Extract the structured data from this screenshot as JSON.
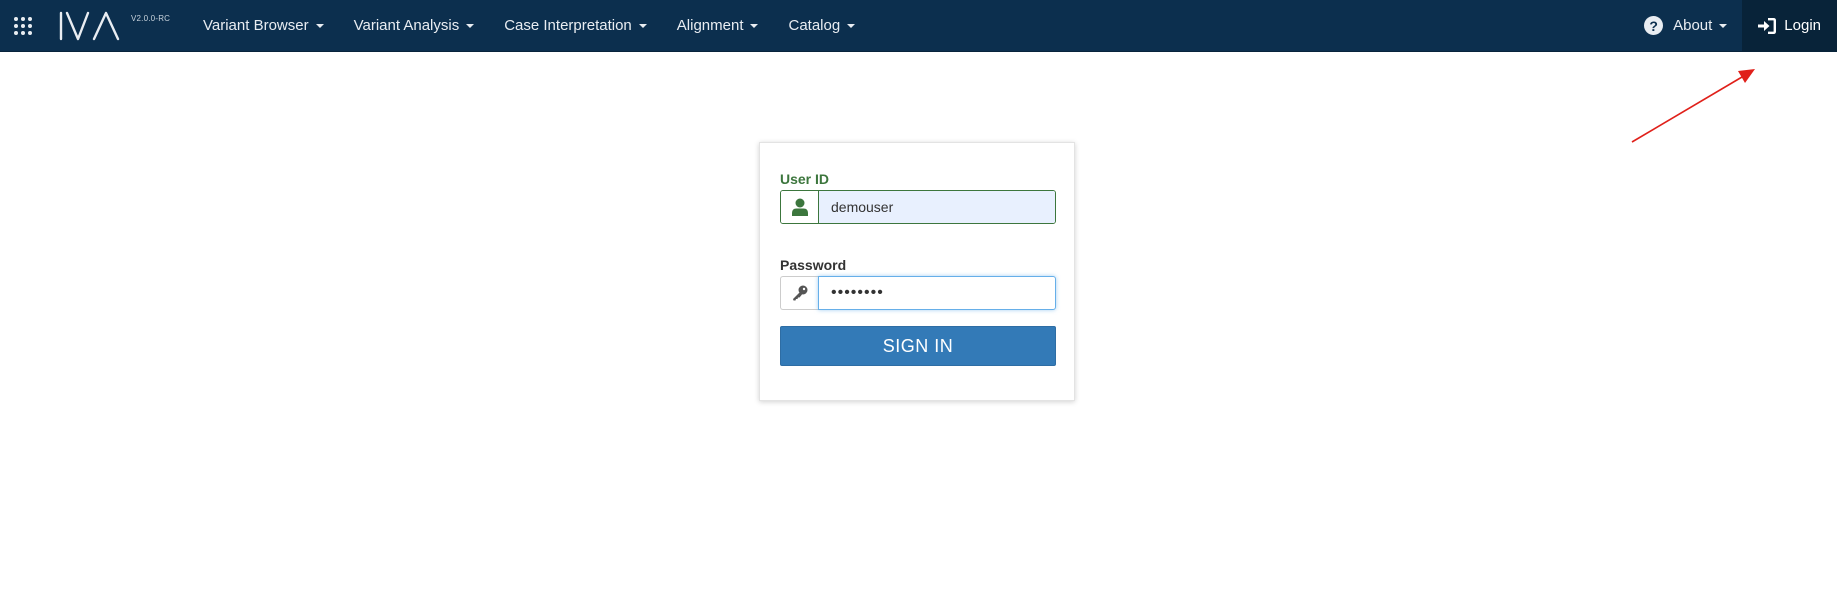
{
  "navbar": {
    "version": "V2.0.0-RC",
    "menu": [
      {
        "label": "Variant Browser"
      },
      {
        "label": "Variant Analysis"
      },
      {
        "label": "Case Interpretation"
      },
      {
        "label": "Alignment"
      },
      {
        "label": "Catalog"
      }
    ],
    "about_label": "About",
    "login_label": "Login"
  },
  "login_form": {
    "user_label": "User ID",
    "user_value": "demouser",
    "password_label": "Password",
    "password_value": "••••••••",
    "submit_label": "SIGN IN"
  },
  "icons": {
    "apps": "apps-grid-icon",
    "user": "user-icon",
    "key": "key-icon",
    "login": "sign-in-icon",
    "about": "question-circle-icon"
  },
  "colors": {
    "navbar_bg": "#0c2f4e",
    "login_bg": "#082339",
    "primary_button": "#337ab7",
    "success_green": "#3c763d",
    "annotation_arrow": "#e0201a"
  }
}
